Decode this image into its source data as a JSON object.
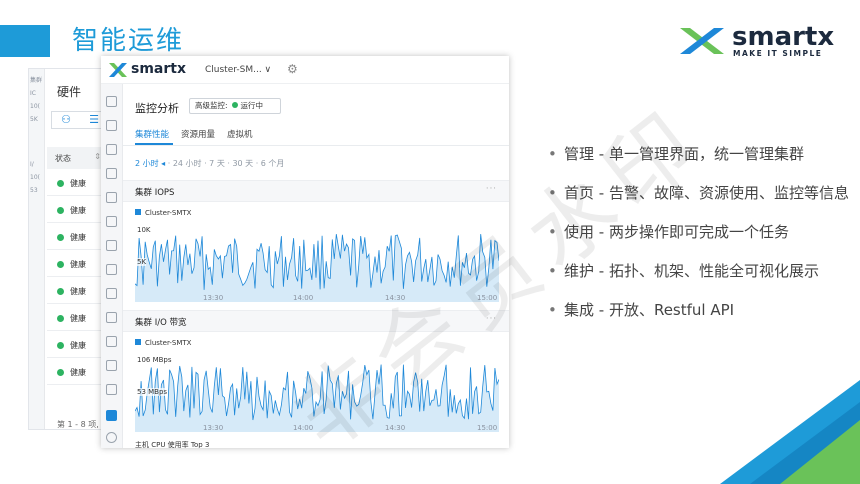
{
  "slide": {
    "title": "智能运维",
    "brand": {
      "name": "smartx",
      "tagline": "MAKE IT SIMPLE"
    },
    "watermark": "非会员水印"
  },
  "back_window": {
    "sidebar_fragments": [
      "集群",
      "IC",
      "10(",
      "5K",
      "I/",
      "10(",
      "53"
    ],
    "title": "硬件",
    "status_header": "状态",
    "rows": [
      "健康",
      "健康",
      "健康",
      "健康",
      "健康",
      "健康",
      "健康",
      "健康"
    ],
    "footer": "第 1 - 8 项,"
  },
  "front_window": {
    "brand": "smartx",
    "cluster_select": "Cluster-SM... ∨",
    "monitor_title": "监控分析",
    "badge_label": "高级监控:",
    "badge_status": "运行中",
    "tabs": [
      "集群性能",
      "资源用量",
      "虚拟机"
    ],
    "range": {
      "active": "2 小时 ◂",
      "others": "· 24 小时 · 7 天 · 30 天 · 6 个月"
    },
    "panels": [
      {
        "title": "集群 IOPS",
        "series": "Cluster-SMTX",
        "y_top": "10K",
        "y_mid": "5K",
        "x_ticks": [
          "13:30",
          "14:00",
          "14:30",
          "15:00"
        ]
      },
      {
        "title": "集群 I/O 带宽",
        "series": "Cluster-SMTX",
        "y_top": "106 MBps",
        "y_mid": "53 MBps",
        "x_ticks": [
          "13:30",
          "14:00",
          "14:30",
          "15:00"
        ]
      }
    ],
    "more_label": "···",
    "cut_text": "主机 CPU 使用率 Top 3"
  },
  "bullets": [
    "管理 - 单一管理界面，统一管理集群",
    "首页 - 告警、故障、资源使用、监控等信息",
    "使用 -  两步操作即可完成一个任务",
    "维护 - 拓扑、机架、性能全可视化展示",
    "集成 - 开放、Restful API"
  ],
  "colors": {
    "accent": "#1e9bd8",
    "logo_blue": "#1e88d8",
    "logo_green": "#6ac259",
    "healthy": "#2db361"
  }
}
